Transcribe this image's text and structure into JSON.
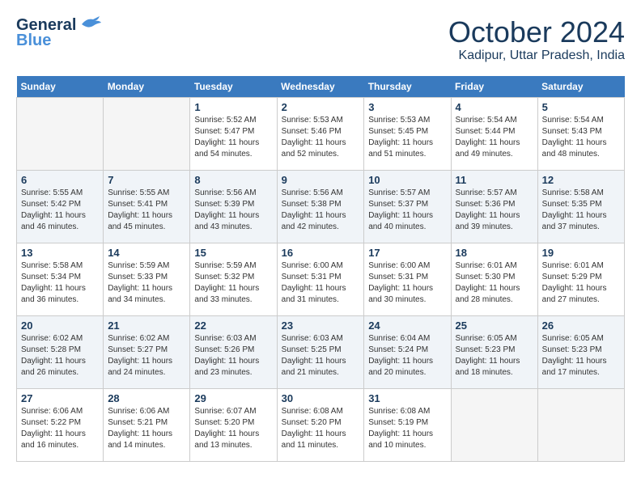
{
  "header": {
    "logo_line1": "General",
    "logo_line2": "Blue",
    "month": "October 2024",
    "location": "Kadipur, Uttar Pradesh, India"
  },
  "days_of_week": [
    "Sunday",
    "Monday",
    "Tuesday",
    "Wednesday",
    "Thursday",
    "Friday",
    "Saturday"
  ],
  "weeks": [
    [
      {
        "day": "",
        "sunrise": "",
        "sunset": "",
        "daylight": ""
      },
      {
        "day": "",
        "sunrise": "",
        "sunset": "",
        "daylight": ""
      },
      {
        "day": "1",
        "sunrise": "Sunrise: 5:52 AM",
        "sunset": "Sunset: 5:47 PM",
        "daylight": "Daylight: 11 hours and 54 minutes."
      },
      {
        "day": "2",
        "sunrise": "Sunrise: 5:53 AM",
        "sunset": "Sunset: 5:46 PM",
        "daylight": "Daylight: 11 hours and 52 minutes."
      },
      {
        "day": "3",
        "sunrise": "Sunrise: 5:53 AM",
        "sunset": "Sunset: 5:45 PM",
        "daylight": "Daylight: 11 hours and 51 minutes."
      },
      {
        "day": "4",
        "sunrise": "Sunrise: 5:54 AM",
        "sunset": "Sunset: 5:44 PM",
        "daylight": "Daylight: 11 hours and 49 minutes."
      },
      {
        "day": "5",
        "sunrise": "Sunrise: 5:54 AM",
        "sunset": "Sunset: 5:43 PM",
        "daylight": "Daylight: 11 hours and 48 minutes."
      }
    ],
    [
      {
        "day": "6",
        "sunrise": "Sunrise: 5:55 AM",
        "sunset": "Sunset: 5:42 PM",
        "daylight": "Daylight: 11 hours and 46 minutes."
      },
      {
        "day": "7",
        "sunrise": "Sunrise: 5:55 AM",
        "sunset": "Sunset: 5:41 PM",
        "daylight": "Daylight: 11 hours and 45 minutes."
      },
      {
        "day": "8",
        "sunrise": "Sunrise: 5:56 AM",
        "sunset": "Sunset: 5:39 PM",
        "daylight": "Daylight: 11 hours and 43 minutes."
      },
      {
        "day": "9",
        "sunrise": "Sunrise: 5:56 AM",
        "sunset": "Sunset: 5:38 PM",
        "daylight": "Daylight: 11 hours and 42 minutes."
      },
      {
        "day": "10",
        "sunrise": "Sunrise: 5:57 AM",
        "sunset": "Sunset: 5:37 PM",
        "daylight": "Daylight: 11 hours and 40 minutes."
      },
      {
        "day": "11",
        "sunrise": "Sunrise: 5:57 AM",
        "sunset": "Sunset: 5:36 PM",
        "daylight": "Daylight: 11 hours and 39 minutes."
      },
      {
        "day": "12",
        "sunrise": "Sunrise: 5:58 AM",
        "sunset": "Sunset: 5:35 PM",
        "daylight": "Daylight: 11 hours and 37 minutes."
      }
    ],
    [
      {
        "day": "13",
        "sunrise": "Sunrise: 5:58 AM",
        "sunset": "Sunset: 5:34 PM",
        "daylight": "Daylight: 11 hours and 36 minutes."
      },
      {
        "day": "14",
        "sunrise": "Sunrise: 5:59 AM",
        "sunset": "Sunset: 5:33 PM",
        "daylight": "Daylight: 11 hours and 34 minutes."
      },
      {
        "day": "15",
        "sunrise": "Sunrise: 5:59 AM",
        "sunset": "Sunset: 5:32 PM",
        "daylight": "Daylight: 11 hours and 33 minutes."
      },
      {
        "day": "16",
        "sunrise": "Sunrise: 6:00 AM",
        "sunset": "Sunset: 5:31 PM",
        "daylight": "Daylight: 11 hours and 31 minutes."
      },
      {
        "day": "17",
        "sunrise": "Sunrise: 6:00 AM",
        "sunset": "Sunset: 5:31 PM",
        "daylight": "Daylight: 11 hours and 30 minutes."
      },
      {
        "day": "18",
        "sunrise": "Sunrise: 6:01 AM",
        "sunset": "Sunset: 5:30 PM",
        "daylight": "Daylight: 11 hours and 28 minutes."
      },
      {
        "day": "19",
        "sunrise": "Sunrise: 6:01 AM",
        "sunset": "Sunset: 5:29 PM",
        "daylight": "Daylight: 11 hours and 27 minutes."
      }
    ],
    [
      {
        "day": "20",
        "sunrise": "Sunrise: 6:02 AM",
        "sunset": "Sunset: 5:28 PM",
        "daylight": "Daylight: 11 hours and 26 minutes."
      },
      {
        "day": "21",
        "sunrise": "Sunrise: 6:02 AM",
        "sunset": "Sunset: 5:27 PM",
        "daylight": "Daylight: 11 hours and 24 minutes."
      },
      {
        "day": "22",
        "sunrise": "Sunrise: 6:03 AM",
        "sunset": "Sunset: 5:26 PM",
        "daylight": "Daylight: 11 hours and 23 minutes."
      },
      {
        "day": "23",
        "sunrise": "Sunrise: 6:03 AM",
        "sunset": "Sunset: 5:25 PM",
        "daylight": "Daylight: 11 hours and 21 minutes."
      },
      {
        "day": "24",
        "sunrise": "Sunrise: 6:04 AM",
        "sunset": "Sunset: 5:24 PM",
        "daylight": "Daylight: 11 hours and 20 minutes."
      },
      {
        "day": "25",
        "sunrise": "Sunrise: 6:05 AM",
        "sunset": "Sunset: 5:23 PM",
        "daylight": "Daylight: 11 hours and 18 minutes."
      },
      {
        "day": "26",
        "sunrise": "Sunrise: 6:05 AM",
        "sunset": "Sunset: 5:23 PM",
        "daylight": "Daylight: 11 hours and 17 minutes."
      }
    ],
    [
      {
        "day": "27",
        "sunrise": "Sunrise: 6:06 AM",
        "sunset": "Sunset: 5:22 PM",
        "daylight": "Daylight: 11 hours and 16 minutes."
      },
      {
        "day": "28",
        "sunrise": "Sunrise: 6:06 AM",
        "sunset": "Sunset: 5:21 PM",
        "daylight": "Daylight: 11 hours and 14 minutes."
      },
      {
        "day": "29",
        "sunrise": "Sunrise: 6:07 AM",
        "sunset": "Sunset: 5:20 PM",
        "daylight": "Daylight: 11 hours and 13 minutes."
      },
      {
        "day": "30",
        "sunrise": "Sunrise: 6:08 AM",
        "sunset": "Sunset: 5:20 PM",
        "daylight": "Daylight: 11 hours and 11 minutes."
      },
      {
        "day": "31",
        "sunrise": "Sunrise: 6:08 AM",
        "sunset": "Sunset: 5:19 PM",
        "daylight": "Daylight: 11 hours and 10 minutes."
      },
      {
        "day": "",
        "sunrise": "",
        "sunset": "",
        "daylight": ""
      },
      {
        "day": "",
        "sunrise": "",
        "sunset": "",
        "daylight": ""
      }
    ]
  ]
}
